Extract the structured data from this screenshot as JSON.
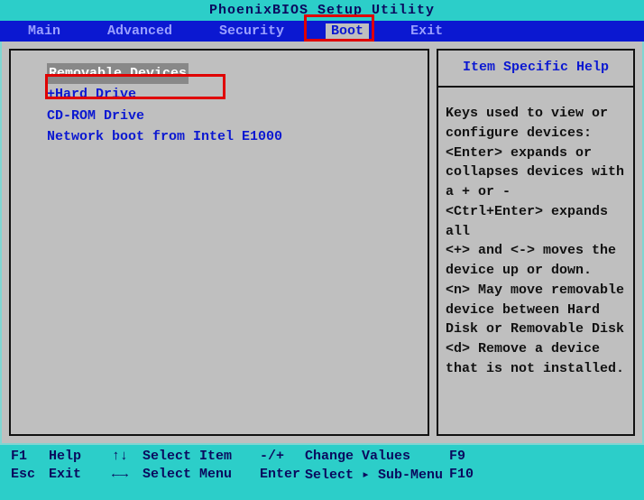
{
  "title": "PhoenixBIOS Setup Utility",
  "menu": {
    "items": [
      "Main",
      "Advanced",
      "Security",
      "Boot",
      "Exit"
    ],
    "active_index": 3
  },
  "boot": {
    "items": [
      {
        "label": "Removable Devices",
        "selected": true,
        "marker": ""
      },
      {
        "label": "Hard Drive",
        "selected": false,
        "marker": "+"
      },
      {
        "label": "CD-ROM Drive",
        "selected": false,
        "marker": ""
      },
      {
        "label": "Network boot from Intel E1000",
        "selected": false,
        "marker": ""
      }
    ]
  },
  "help": {
    "title": "Item Specific Help",
    "body": "Keys used to view or configure devices:\n<Enter> expands or collapses devices with a + or -\n<Ctrl+Enter> expands all\n<+> and <-> moves the device up or down.\n<n> May move removable device between Hard Disk or Removable Disk\n<d> Remove a device that is not installed."
  },
  "footer": {
    "row1": {
      "k1": "F1",
      "l1": "Help",
      "k2": "↑↓",
      "l2": "Select Item",
      "k3": "-/+",
      "l3": "Change Values",
      "k4": "F9"
    },
    "row2": {
      "k1": "Esc",
      "l1": "Exit",
      "k2": "←→",
      "l2": "Select Menu",
      "k3": "Enter",
      "l3": "Select ▸ Sub-Menu",
      "k4": "F10"
    }
  }
}
